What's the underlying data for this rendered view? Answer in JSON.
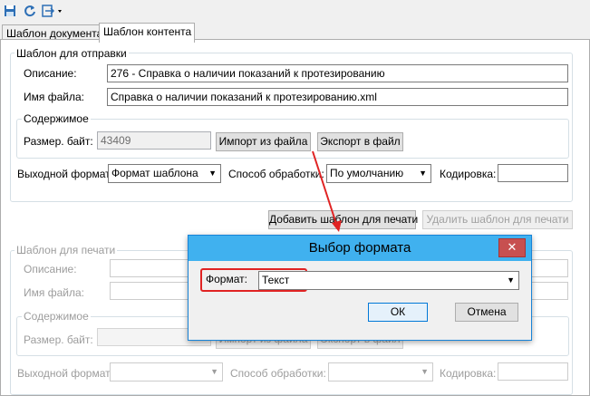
{
  "toolbar": {
    "icons": [
      "save-icon",
      "refresh-icon",
      "export-menu-icon"
    ]
  },
  "tabs": {
    "doc_template": "Шаблон документа",
    "content_template": "Шаблон контента"
  },
  "send_template": {
    "legend": "Шаблон для отправки",
    "description_label": "Описание:",
    "description_value": "276 - Справка о наличии показаний к протезированию",
    "filename_label": "Имя файла:",
    "filename_value": "Справка о наличии показаний к протезированию.xml",
    "content_legend": "Содержимое",
    "size_label": "Размер. байт:",
    "size_value": "43409",
    "import_button": "Импорт из файла",
    "export_button": "Экспорт в файл",
    "output_format_label": "Выходной формат:",
    "output_format_value": "Формат шаблона",
    "processing_label": "Способ обработки:",
    "processing_value": "По умолчанию",
    "encoding_label": "Кодировка:",
    "encoding_value": ""
  },
  "print_buttons": {
    "add": "Добавить шаблон для печати",
    "remove": "Удалить шаблон для печати"
  },
  "print_template": {
    "legend": "Шаблон для печати",
    "description_label": "Описание:",
    "filename_label": "Имя файла:",
    "content_legend": "Содержимое",
    "size_label": "Размер. байт:",
    "import_button": "Импорт из файла",
    "export_button": "Экспорт в файл",
    "output_format_label": "Выходной формат:",
    "processing_label": "Способ обработки:",
    "encoding_label": "Кодировка:"
  },
  "dialog": {
    "title": "Выбор формата",
    "close": "✕",
    "format_label": "Формат:",
    "format_value": "Текст",
    "ok_button": "ОК",
    "cancel_button": "Отмена"
  },
  "colors": {
    "accent": "#40b1ef",
    "highlight": "#e02323",
    "close": "#c75050"
  }
}
